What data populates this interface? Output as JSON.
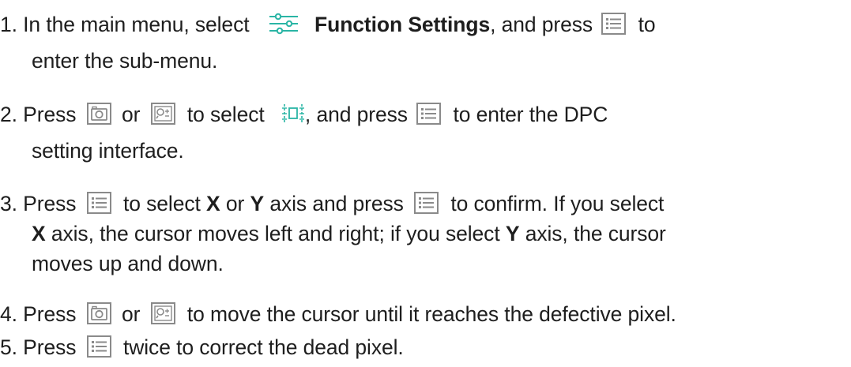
{
  "steps": [
    {
      "number": "1.",
      "l1_a": "In the main menu, select",
      "l1_b": "Function Settings",
      "l1_c": ", and press",
      "l1_d": "to",
      "l2_a": "enter the sub-menu."
    },
    {
      "number": "2.",
      "l1_a": "Press",
      "l1_b": "or",
      "l1_c": "to select",
      "l1_d": ", and press",
      "l1_e": "to enter the DPC",
      "l2_a": "setting interface."
    },
    {
      "number": "3.",
      "l1_a": "Press",
      "l1_b": "to select",
      "l1_c": "X",
      "l1_d": "or",
      "l1_e": "Y",
      "l1_f": "axis and press",
      "l1_g": "to confirm. If you select",
      "l2_a": "X",
      "l2_b": "axis, the cursor moves left and right; if you select",
      "l2_c": "Y",
      "l2_d": "axis, the cursor",
      "l3_a": "moves up and down."
    },
    {
      "number": "4.",
      "l1_a": "Press",
      "l1_b": "or",
      "l1_c": "to move the cursor until it reaches the defective pixel."
    },
    {
      "number": "5.",
      "l1_a": "Press",
      "l1_b": "twice to correct the dead pixel."
    }
  ],
  "icons": {
    "settings": "function-settings-icon",
    "menu": "menu-button-icon",
    "camera": "camera-button-icon",
    "zoom": "zoom-button-icon",
    "dpc": "dpc-icon"
  },
  "colors": {
    "text": "#1e1e1e",
    "accent": "#2ab5a5",
    "icon_stroke": "#8a8a8a"
  }
}
